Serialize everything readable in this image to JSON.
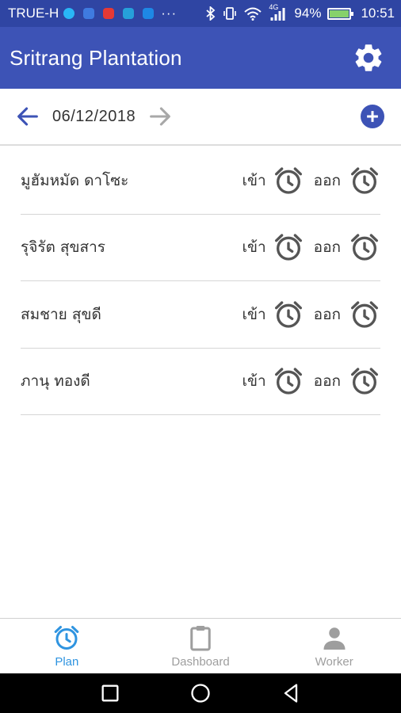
{
  "status_bar": {
    "carrier": "TRUE-H",
    "more": "···",
    "battery": "94%",
    "time": "10:51",
    "network": "4G",
    "notification_colors": [
      "#29b6f6",
      "#3f7be0",
      "#e53935",
      "#26a0da",
      "#1e88e5"
    ]
  },
  "app_bar": {
    "title": "Sritrang Plantation",
    "settings_icon": "gear-icon"
  },
  "date_nav": {
    "date": "06/12/2018",
    "prev_icon": "arrow-left-icon",
    "next_icon": "arrow-right-icon",
    "add_icon": "add-circle-icon"
  },
  "workers": [
    {
      "name": "มูฮัมหมัด ดาโซะ",
      "in_label": "เข้า",
      "out_label": "ออก"
    },
    {
      "name": "รุจิรัต สุขสาร",
      "in_label": "เข้า",
      "out_label": "ออก"
    },
    {
      "name": "สมชาย สุขดี",
      "in_label": "เข้า",
      "out_label": "ออก"
    },
    {
      "name": "ภานุ ทองดี",
      "in_label": "เข้า",
      "out_label": "ออก"
    }
  ],
  "bottom_nav": {
    "tabs": [
      {
        "label": "Plan",
        "icon": "alarm-icon",
        "active": true
      },
      {
        "label": "Dashboard",
        "icon": "clipboard-icon",
        "active": false
      },
      {
        "label": "Worker",
        "icon": "person-icon",
        "active": false
      }
    ]
  },
  "colors": {
    "status_bar": "#2f45a3",
    "app_bar": "#3d53b6",
    "accent": "#3d53b6",
    "active_tab": "#2f94e0",
    "inactive_tab": "#9e9e9e",
    "alarm_icon": "#555555"
  }
}
